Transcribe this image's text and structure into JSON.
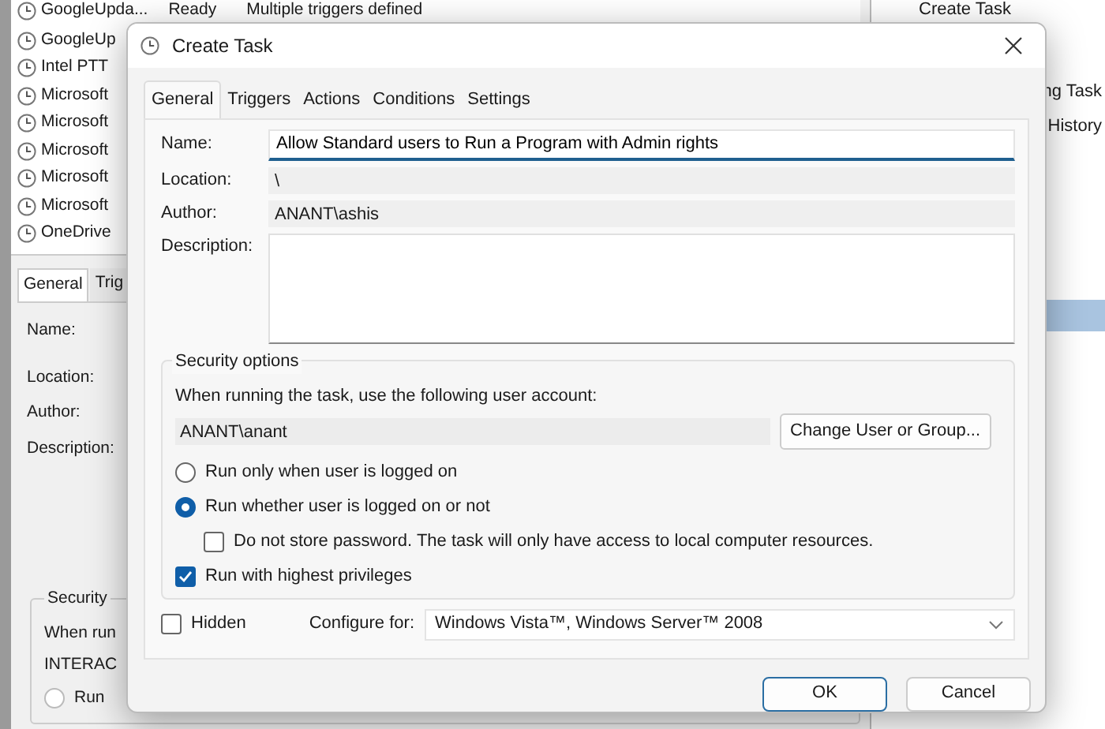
{
  "background": {
    "task_list": [
      {
        "name": "GoogleUpda...",
        "status": "Ready",
        "triggers": "Multiple triggers defined"
      },
      {
        "name": "GoogleUp"
      },
      {
        "name": "Intel PTT"
      },
      {
        "name": "Microsoft"
      },
      {
        "name": "Microsoft"
      },
      {
        "name": "Microsoft"
      },
      {
        "name": "Microsoft"
      },
      {
        "name": "Microsoft"
      },
      {
        "name": "OneDrive"
      }
    ],
    "actions": [
      {
        "label": "Create Task"
      },
      {
        "label": "ng Task"
      },
      {
        "label": "History"
      }
    ],
    "tabs": [
      {
        "label": "General",
        "selected": true
      },
      {
        "label": "Trig",
        "selected": false
      }
    ],
    "fields": [
      "Name:",
      "Location:",
      "Author:",
      "Description:"
    ],
    "security": {
      "title": "Security",
      "lines": [
        "When run",
        "INTERAC"
      ],
      "radio": {
        "label": "Run",
        "selected": false
      }
    }
  },
  "dialog": {
    "title": "Create Task",
    "tabs": [
      {
        "label": "General",
        "selected": true
      },
      {
        "label": "Triggers",
        "selected": false
      },
      {
        "label": "Actions",
        "selected": false
      },
      {
        "label": "Conditions",
        "selected": false
      },
      {
        "label": "Settings",
        "selected": false
      }
    ],
    "name": {
      "label": "Name:",
      "value": "Allow Standard users to Run a Program with Admin rights"
    },
    "location": {
      "label": "Location:",
      "value": "\\"
    },
    "author": {
      "label": "Author:",
      "value": "ANANT\\ashis"
    },
    "description": {
      "label": "Description:"
    },
    "security": {
      "title": "Security options",
      "prompt": "When running the task, use the following user account:",
      "account": "ANANT\\anant",
      "change_button": "Change User or Group...",
      "options": [
        {
          "kind": "radio",
          "label": "Run only when user is logged on",
          "selected": false
        },
        {
          "kind": "radio",
          "label": "Run whether user is logged on or not",
          "selected": true,
          "children": [
            {
              "kind": "checkbox",
              "label": "Do not store password.  The task will only have access to local computer resources.",
              "checked": false
            }
          ]
        },
        {
          "kind": "checkbox",
          "label": "Run with highest privileges",
          "checked": true
        }
      ]
    },
    "hidden": {
      "label": "Hidden",
      "checked": false
    },
    "configure": {
      "label": "Configure for:",
      "value": "Windows Vista™, Windows Server™ 2008"
    },
    "buttons": [
      {
        "label": "OK",
        "kind": "default"
      },
      {
        "label": "Cancel",
        "kind": "normal"
      }
    ]
  }
}
